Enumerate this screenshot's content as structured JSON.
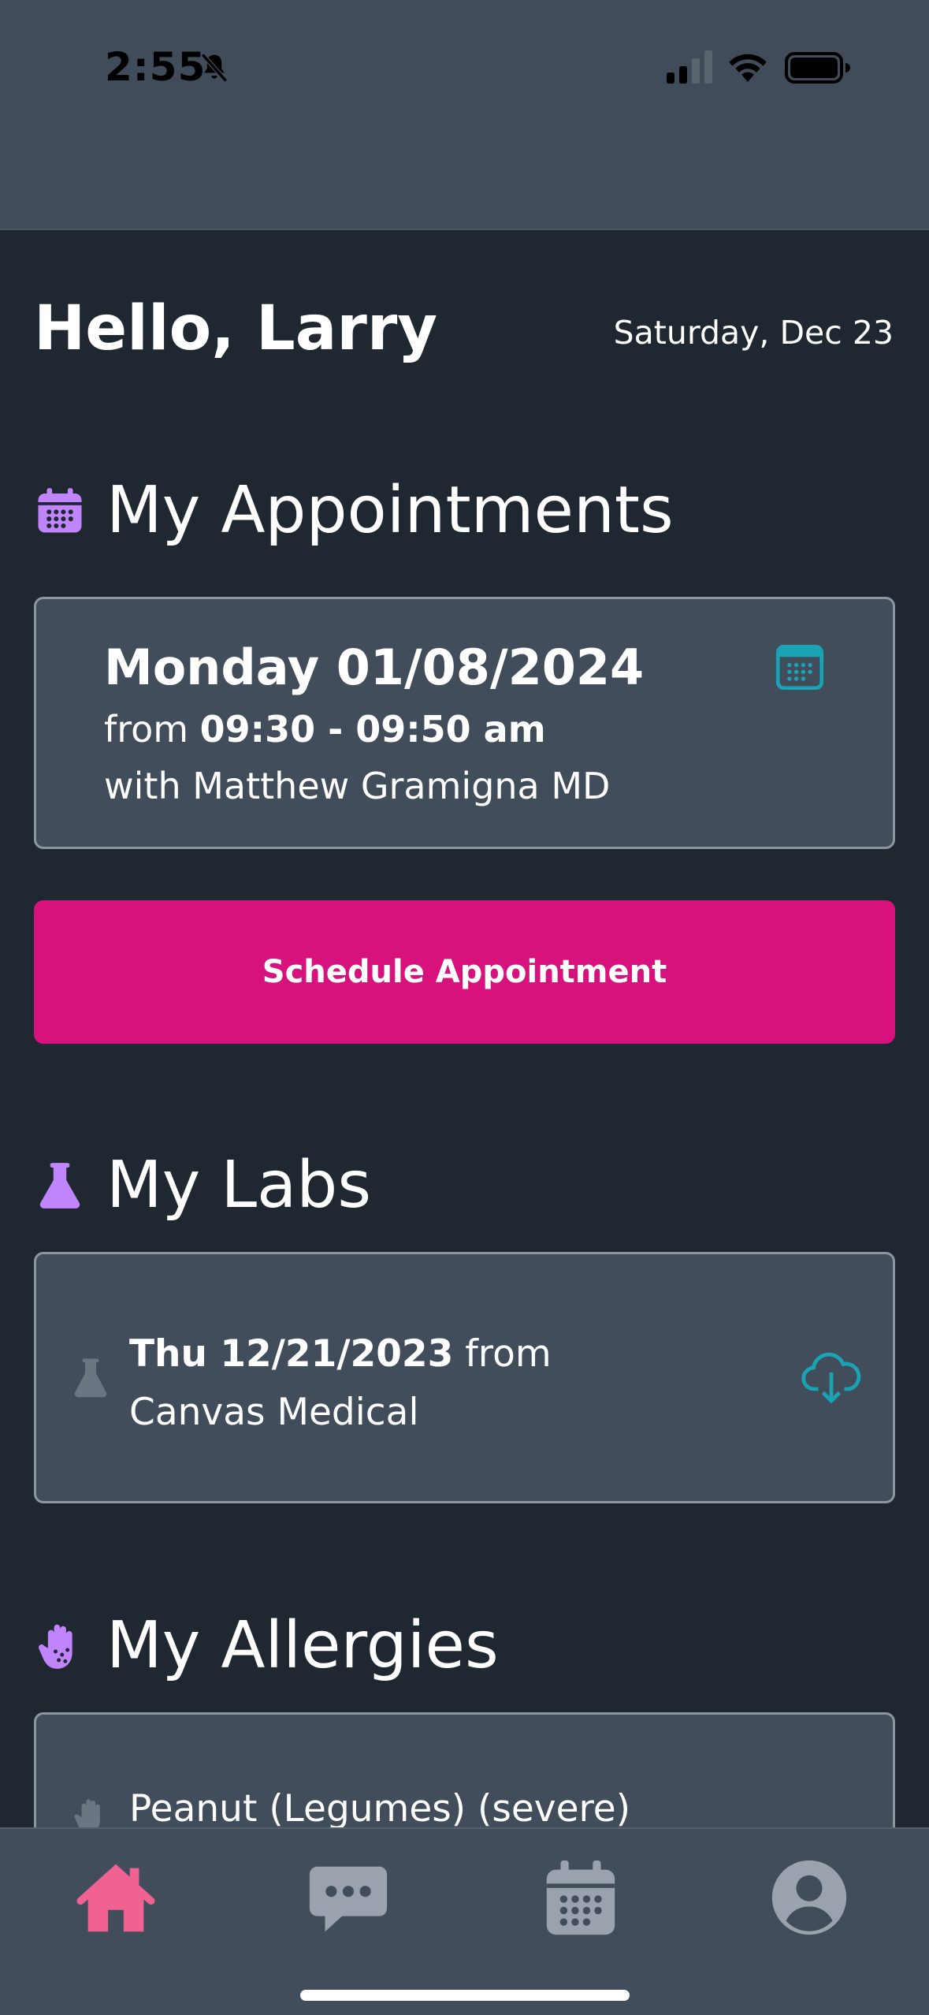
{
  "status_bar": {
    "time": "2:55"
  },
  "greeting": {
    "text": "Hello, Larry",
    "date": "Saturday, Dec 23"
  },
  "appointments": {
    "title": "My Appointments",
    "card": {
      "date": "Monday 01/08/2024",
      "from_prefix": "from ",
      "time_range": "09:30 - 09:50 am",
      "doctor": "with Matthew Gramigna MD"
    },
    "schedule_button": "Schedule Appointment"
  },
  "labs": {
    "title": "My Labs",
    "card": {
      "date": "Thu 12/21/2023",
      "source": " from Canvas Medical"
    }
  },
  "allergies": {
    "title": "My Allergies",
    "items": [
      {
        "label": "Peanut (Legumes) (severe)"
      }
    ]
  },
  "nav": {
    "items": [
      {
        "icon": "home-icon",
        "active": true
      },
      {
        "icon": "chat-icon",
        "active": false
      },
      {
        "icon": "calendar-icon",
        "active": false
      },
      {
        "icon": "profile-icon",
        "active": false
      }
    ]
  },
  "colors": {
    "background": "#1f2731",
    "header": "#404c59",
    "card": "#414d5a",
    "accent_pink": "#d8127d",
    "nav_active": "#f06292",
    "section_icon": "#c084fc",
    "teal_icon": "#1aa3b4"
  }
}
